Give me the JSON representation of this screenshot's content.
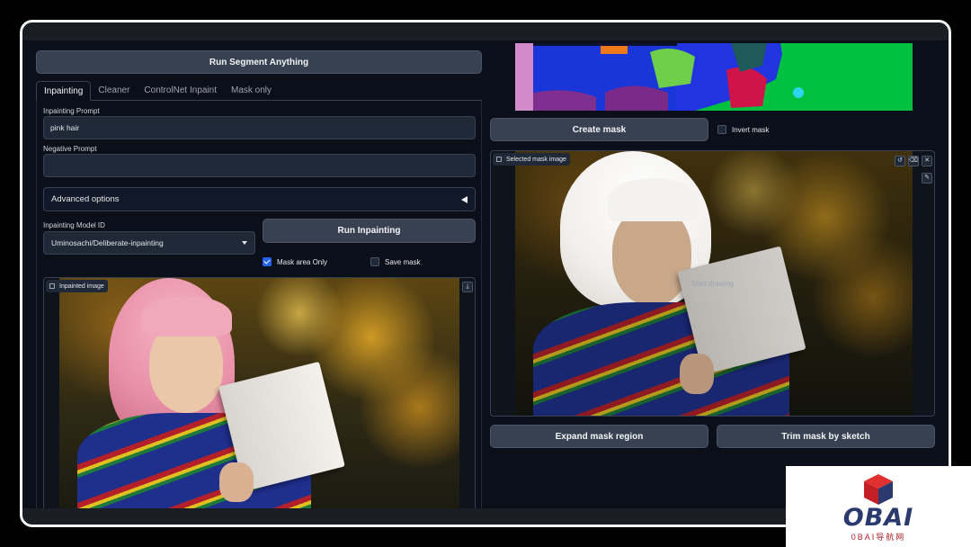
{
  "left": {
    "segment_button": "Run Segment Anything",
    "tabs": [
      {
        "label": "Inpainting",
        "active": true
      },
      {
        "label": "Cleaner",
        "active": false
      },
      {
        "label": "ControlNet Inpaint",
        "active": false
      },
      {
        "label": "Mask only",
        "active": false
      }
    ],
    "prompt_label": "Inpainting Prompt",
    "prompt_value": "pink hair",
    "negative_label": "Negative Prompt",
    "negative_value": "",
    "advanced_label": "Advanced options",
    "model_label": "Inpainting Model ID",
    "model_value": "Uminosachi/Deliberate-inpainting",
    "run_button": "Run Inpainting",
    "mask_area_only": {
      "label": "Mask area Only",
      "checked": true
    },
    "save_mask": {
      "label": "Save mask",
      "checked": false
    },
    "output_label": "Inpainted image"
  },
  "right": {
    "create_mask_button": "Create mask",
    "invert_mask": {
      "label": "Invert mask",
      "checked": false
    },
    "mask_image_label": "Selected mask image",
    "canvas_hint": "Start drawing",
    "expand_button": "Expand mask region",
    "trim_button": "Trim mask by sketch"
  },
  "colors": {
    "background": "#0b0f19",
    "button": "#374151",
    "accent": "#2563eb",
    "pink_hair": "#e88fa8",
    "white_mask": "#f1efec"
  },
  "icons": {
    "image": "image-icon",
    "download": "download-icon",
    "undo": "undo-icon",
    "clear": "eraser-icon",
    "close": "close-icon",
    "brush": "brush-icon"
  },
  "watermark": {
    "brand": "OBAI",
    "subtitle": "0BAI导航网"
  }
}
